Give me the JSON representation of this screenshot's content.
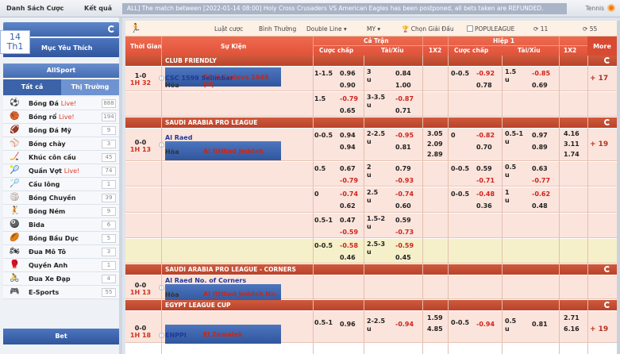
{
  "topbar": {
    "nav": [
      "Danh Sách Cược",
      "Kết quả"
    ],
    "ticker": "ALL] The match between [2022-01-14 08:00] Holy Cross Crusaders VS American Eagles has been postponed, all bets taken are REFUNDED.",
    "sport_label": "Tennis"
  },
  "sidebar": {
    "date": {
      "day": "14",
      "weekday": "Th1"
    },
    "favorites_label": "Mục Yêu Thích",
    "allsport_label": "AllSport",
    "tabs": [
      "Tất cả",
      "Thị Trường"
    ],
    "sports": [
      {
        "icon": "soccer-icon",
        "glyph": "⚽",
        "name": "Bóng Đá",
        "live": "Live!",
        "count": "888"
      },
      {
        "icon": "basketball-icon",
        "glyph": "🏀",
        "name": "Bóng rổ",
        "live": "Live!",
        "count": "194"
      },
      {
        "icon": "american-football-icon",
        "glyph": "🏈",
        "name": "Bóng Đá Mỹ",
        "live": "",
        "count": "9"
      },
      {
        "icon": "baseball-icon",
        "glyph": "⚾",
        "name": "Bóng chày",
        "live": "",
        "count": "3"
      },
      {
        "icon": "hockey-icon",
        "glyph": "🏒",
        "name": "Khúc côn cầu",
        "live": "",
        "count": "45"
      },
      {
        "icon": "tennis-icon",
        "glyph": "🎾",
        "name": "Quần Vợt",
        "live": "Live!",
        "count": "74"
      },
      {
        "icon": "badminton-icon",
        "glyph": "🏸",
        "name": "Cầu lông",
        "live": "",
        "count": "1"
      },
      {
        "icon": "volleyball-icon",
        "glyph": "🏐",
        "name": "Bóng Chuyền",
        "live": "",
        "count": "39"
      },
      {
        "icon": "handball-icon",
        "glyph": "🤾",
        "name": "Bóng Ném",
        "live": "",
        "count": "9"
      },
      {
        "icon": "billiards-icon",
        "glyph": "🎱",
        "name": "Bida",
        "live": "",
        "count": "6"
      },
      {
        "icon": "rugby-icon",
        "glyph": "🏉",
        "name": "Bóng Bầu Dục",
        "live": "",
        "count": "5"
      },
      {
        "icon": "motor-racing-icon",
        "glyph": "🏍",
        "name": "Đua Mô Tô",
        "live": "",
        "count": "3"
      },
      {
        "icon": "boxing-icon",
        "glyph": "🥊",
        "name": "Quyền Anh",
        "live": "",
        "count": "1"
      },
      {
        "icon": "cycling-icon",
        "glyph": "🚴",
        "name": "Đua Xe Đạp",
        "live": "",
        "count": "4"
      },
      {
        "icon": "esports-icon",
        "glyph": "🎮",
        "name": "E-Sports",
        "live": "",
        "count": "55"
      }
    ],
    "bet_label": "Bet"
  },
  "filters": {
    "rules": "Luật cược",
    "mode": "Bình Thường",
    "double_line": "Double Line ▾",
    "odds_type": "MY ▾",
    "league_select": "Chọn Giải Đấu",
    "popular": "POPULEAGUE",
    "refresh1": "11",
    "refresh2": "55"
  },
  "header": {
    "time": "Thời Gian",
    "event": "Sự Kiện",
    "fulltime": "Cả Trận",
    "half1": "Hiệp 1",
    "hdp": "Cược chấp",
    "ou": "Tài/Xỉu",
    "x12": "1X2",
    "more": "More"
  },
  "leagues": [
    {
      "name": "CLUB FRIENDLY"
    },
    {
      "name": "SAUDI ARABIA PRO LEAGUE"
    },
    {
      "name": "SAUDI ARABIA PRO LEAGUE - CORNERS"
    },
    {
      "name": "EGYPT LEAGUE CUP"
    }
  ],
  "matches": [
    {
      "score": "1-0",
      "minute": "1H 32",
      "home": "FC U Craiova 1948 (N)",
      "away": "CSC 1599 Selimbar",
      "draw": "Hòa",
      "more": "+ 17",
      "lines": [
        {
          "ft_hdp": "1-1.5",
          "ft_hdp_o1": "0.96",
          "ft_hdp_o2": "0.90",
          "ft_ou": "3",
          "ft_ou_u": "u",
          "ft_ou_o1": "0.84",
          "ft_ou_o2": "1.00",
          "h1_hdp": "0-0.5",
          "h1_hdp_o1": "-0.92",
          "h1_hdp_o2": "0.78",
          "h1_ou": "1.5",
          "h1_ou_u": "u",
          "h1_ou_o1": "-0.85",
          "h1_ou_o2": "0.69"
        },
        {
          "ft_hdp": "1.5",
          "ft_hdp_o1": "-0.79",
          "ft_hdp_o2": "0.65",
          "ft_ou": "3-3.5",
          "ft_ou_u": "u",
          "ft_ou_o1": "-0.87",
          "ft_ou_o2": "0.71"
        }
      ]
    },
    {
      "score": "0-0",
      "minute": "1H 13",
      "home": "Al Raed",
      "away": "Al Ittihad Jeddah",
      "draw": "Hòa",
      "more": "+ 19",
      "x12": [
        "3.05",
        "2.09",
        "2.89"
      ],
      "h1_x12": [
        "4.16",
        "3.11",
        "1.74"
      ],
      "lines": [
        {
          "ft_hdp": "0-0.5",
          "ft_hdp_o1": "0.94",
          "ft_hdp_o2": "0.94",
          "ft_ou": "2-2.5",
          "ft_ou_u": "u",
          "ft_ou_o1": "-0.95",
          "ft_ou_o2": "0.81",
          "h1_hdp": "0",
          "h1_hdp_o1": "-0.82",
          "h1_hdp_o2": "0.70",
          "h1_ou": "0.5-1",
          "h1_ou_u": "u",
          "h1_ou_o1": "0.97",
          "h1_ou_o2": "0.89"
        },
        {
          "ft_hdp": "0.5",
          "ft_hdp_o1": "0.67",
          "ft_hdp_o2": "-0.79",
          "ft_ou": "2",
          "ft_ou_u": "u",
          "ft_ou_o1": "0.79",
          "ft_ou_o2": "-0.93",
          "h1_hdp": "0-0.5",
          "h1_hdp_o1": "0.59",
          "h1_hdp_o2": "-0.71",
          "h1_ou": "0.5",
          "h1_ou_u": "u",
          "h1_ou_o1": "0.63",
          "h1_ou_o2": "-0.77"
        },
        {
          "ft_hdp": "0",
          "ft_hdp_o1": "-0.74",
          "ft_hdp_o2": "0.62",
          "ft_ou": "2.5",
          "ft_ou_u": "u",
          "ft_ou_o1": "-0.74",
          "ft_ou_o2": "0.60",
          "h1_hdp": "0-0.5",
          "h1_hdp_o1": "-0.48",
          "h1_hdp_o2": "0.36",
          "h1_ou": "1",
          "h1_ou_u": "u",
          "h1_ou_o1": "-0.62",
          "h1_ou_o2": "0.48"
        },
        {
          "ft_hdp": "0.5-1",
          "ft_hdp_o1": "0.47",
          "ft_hdp_o2": "-0.59",
          "ft_ou": "1.5-2",
          "ft_ou_u": "u",
          "ft_ou_o1": "0.59",
          "ft_ou_o2": "-0.73"
        },
        {
          "ft_hdp": "0-0.5",
          "ft_hdp_o1": "-0.58",
          "ft_hdp_o2": "0.46",
          "ft_ou": "2.5-3",
          "ft_ou_u": "u",
          "ft_ou_o1": "-0.59",
          "ft_ou_o2": "0.45"
        }
      ]
    },
    {
      "score": "0-0",
      "minute": "1H 13",
      "home": "Al Raed No. of Corners",
      "away": "Al Ittihad Jeddah No. of Corners",
      "draw": "Hòa"
    },
    {
      "score": "0-0",
      "minute": "1H 18",
      "home": "El Zamalek",
      "away": "ENPPI",
      "more": "+ 19",
      "x12": [
        "1.59",
        "4.85"
      ],
      "h1_x12": [
        "2.71",
        "6.16"
      ],
      "lines": [
        {
          "ft_hdp": "0.5-1",
          "ft_hdp_o1": "0.96",
          "ft_ou": "2-2.5",
          "ft_ou_u": "u",
          "ft_ou_o1": "-0.94",
          "h1_hdp": "0-0.5",
          "h1_hdp_o1": "-0.94",
          "h1_ou": "0.5",
          "h1_ou_u": "u",
          "h1_ou_o1": "0.81"
        }
      ]
    }
  ]
}
